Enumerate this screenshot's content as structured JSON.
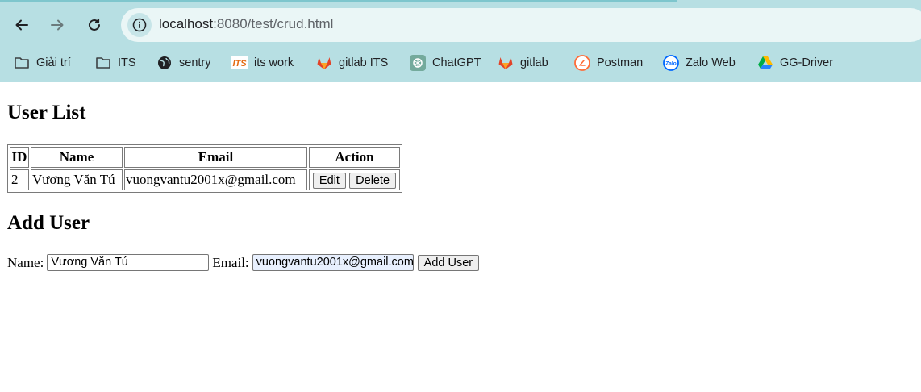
{
  "browser": {
    "url_host": "localhost",
    "url_rest": ":8080/test/crud.html",
    "bookmarks": [
      {
        "label": "Giải trí",
        "icon": "folder-icon"
      },
      {
        "label": "ITS",
        "icon": "folder-icon"
      },
      {
        "label": "sentry",
        "icon": "globe-icon"
      },
      {
        "label": "its work",
        "icon": "its-logo-icon"
      },
      {
        "label": "gitlab ITS",
        "icon": "gitlab-icon"
      },
      {
        "label": "ChatGPT",
        "icon": "chatgpt-icon"
      },
      {
        "label": "gitlab",
        "icon": "gitlab-icon"
      },
      {
        "label": "Postman",
        "icon": "postman-icon"
      },
      {
        "label": "Zalo Web",
        "icon": "zalo-icon"
      },
      {
        "label": "GG-Driver",
        "icon": "google-drive-icon"
      }
    ]
  },
  "page": {
    "user_list_heading": "User List",
    "table": {
      "headers": [
        "ID",
        "Name",
        "Email",
        "Action"
      ],
      "rows": [
        {
          "id": "2",
          "name": "Vương Văn Tú",
          "email": "vuongvantu2001x@gmail.com",
          "edit_label": "Edit",
          "delete_label": "Delete"
        }
      ]
    },
    "add_user_heading": "Add User",
    "form": {
      "name_label": "Name:",
      "name_value": "Vương Văn Tú",
      "email_label": "Email:",
      "email_value": "vuongvantu2001x@gmail.com",
      "submit_label": "Add User"
    }
  },
  "colors": {
    "chrome_bg": "#b7dfe3",
    "omnibox_bg": "#eaf6f6",
    "autofill_bg": "#e8f0fe"
  }
}
